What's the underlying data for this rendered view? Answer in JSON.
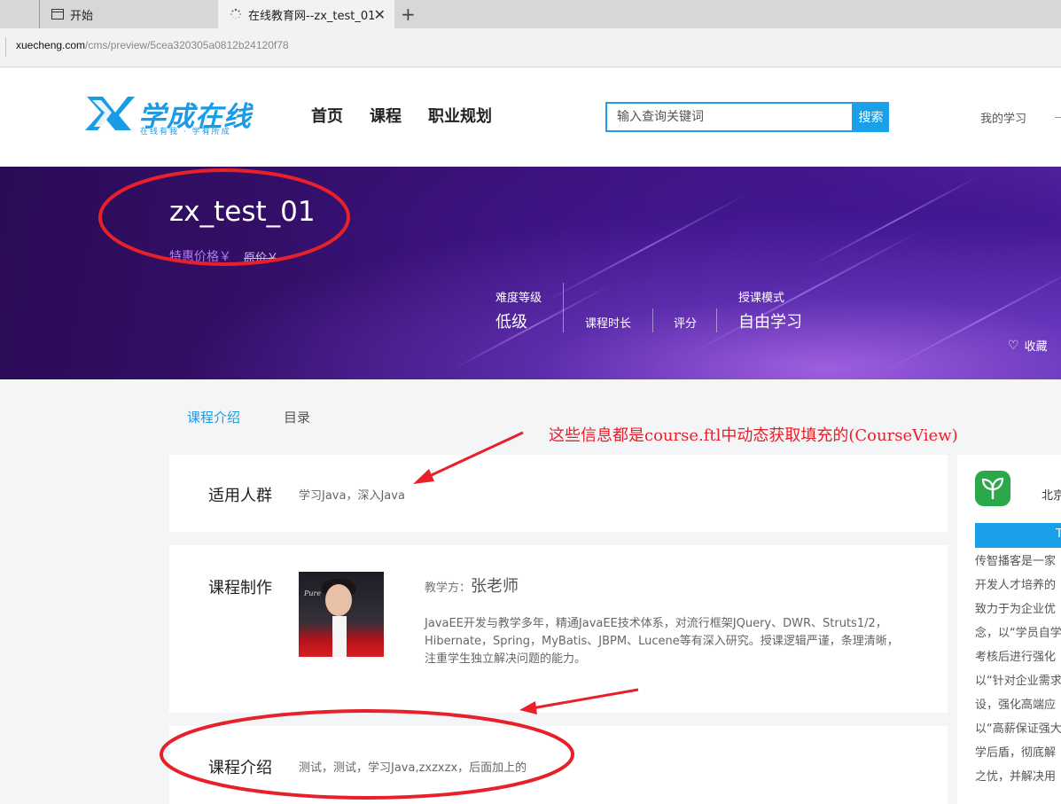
{
  "browser": {
    "tabs": [
      {
        "label": "开始"
      },
      {
        "label": "在线教育网--zx_test_01"
      }
    ],
    "url_host": "xuecheng.com",
    "url_path": "/cms/preview/5cea320305a0812b24120f78"
  },
  "header": {
    "logo_text": "学成在线",
    "logo_subtitle": "在线有我 · 学有所成",
    "nav": [
      "首页",
      "课程",
      "职业规划"
    ],
    "search_placeholder": "输入查询关键词",
    "search_button": "搜索",
    "my_study": "我的学习"
  },
  "banner": {
    "title": "zx_test_01",
    "price_label": "特惠价格￥",
    "original_price_label": "原价￥",
    "difficulty_label": "难度等级",
    "difficulty_value": "低级",
    "duration_label": "课程时长",
    "rating_label": "评分",
    "mode_label": "授课模式",
    "mode_value": "自由学习",
    "favorite": "收藏"
  },
  "tabs": {
    "intro": "课程介绍",
    "catalog": "目录"
  },
  "annotation": "这些信息都是course.ftl中动态获取填充的(CourseView)",
  "audience": {
    "heading": "适用人群",
    "text": "学习Java，深入Java"
  },
  "maker": {
    "heading": "课程制作",
    "photo_text": "Pure",
    "teacher_prefix": "教学方：",
    "teacher_name": "张老师",
    "bio_lines": [
      "JavaEE开发与教学多年，精通JavaEE技术体系，对流行框架JQuery、DWR、Struts1/2，",
      "Hibernate，Spring，MyBatis、JBPM、Lucene等有深入研究。授课逻辑严谨，条理清晰，",
      "注重学生独立解决问题的能力。"
    ]
  },
  "description": {
    "heading": "课程介绍",
    "text": "测试，测试，学习Java,zxzxzx，后面加上的"
  },
  "sidebar": {
    "org_name": "北京",
    "button_label": "T",
    "desc_lines": [
      "传智播客是一家",
      "开发人才培养的",
      "致力于为企业优",
      "念，以“学员自学",
      "考核后进行强化",
      "以“针对企业需求",
      "设，强化高端应",
      "以“高薪保证强大",
      "学后盾，彻底解",
      "之忧，并解决用"
    ]
  },
  "colors": {
    "accent": "#1aa0e8",
    "annotation_red": "#e8202a",
    "price_purple": "#b07af0"
  }
}
